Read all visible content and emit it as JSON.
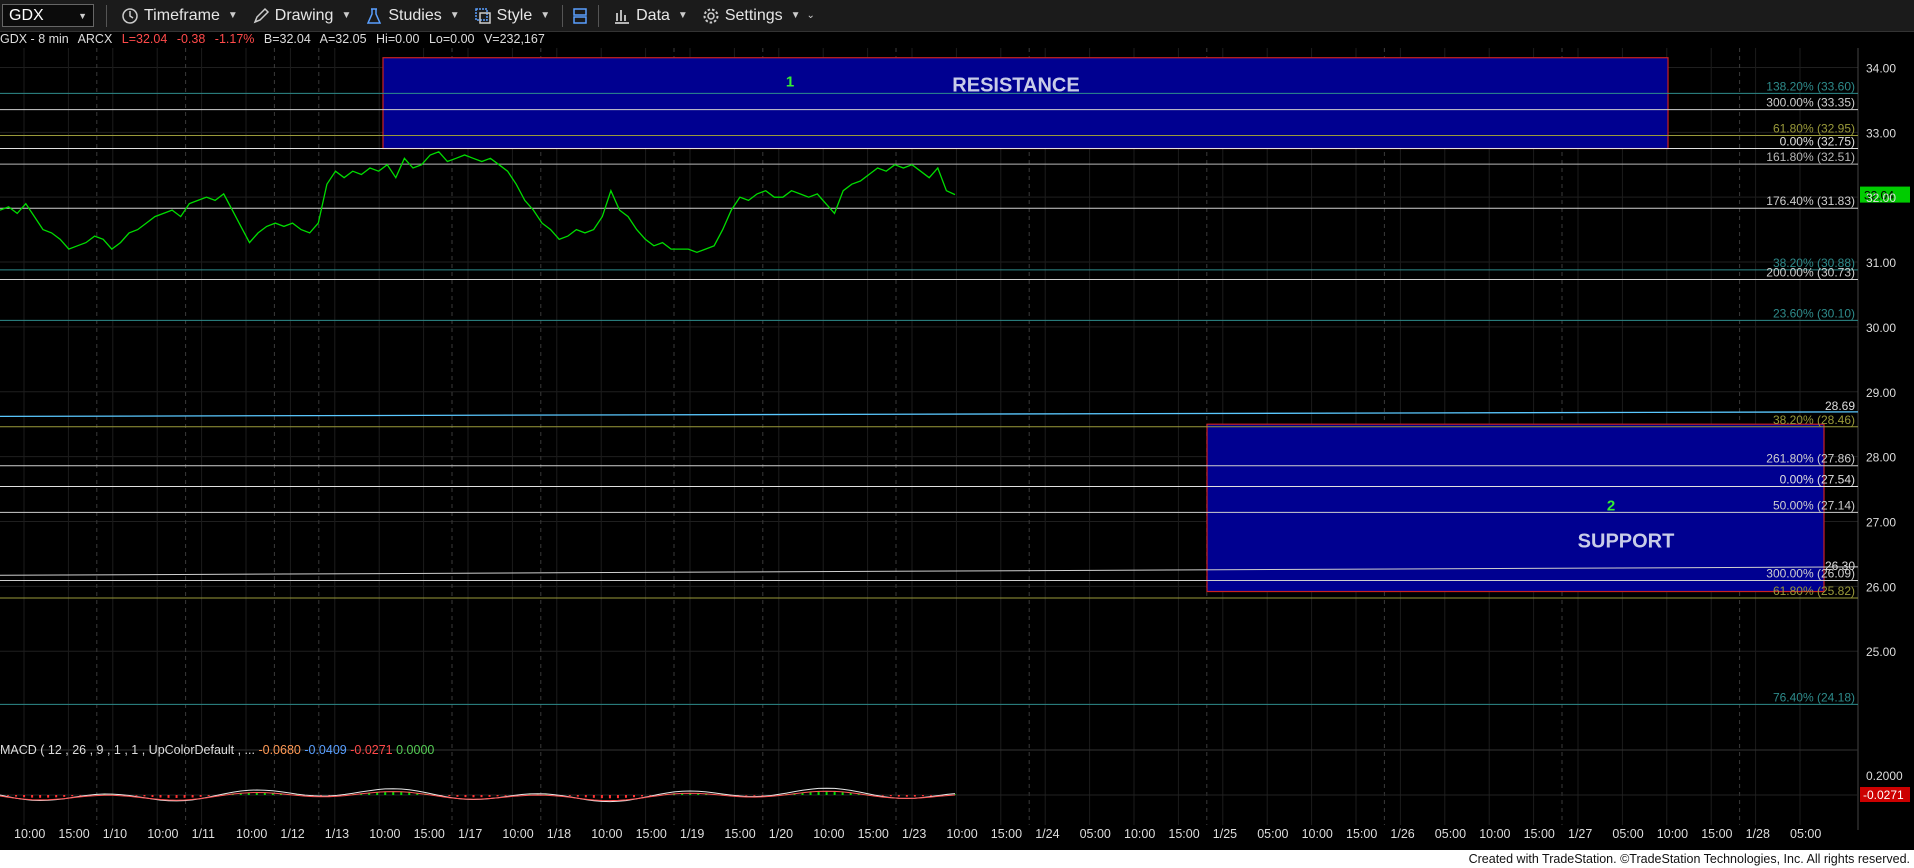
{
  "toolbar": {
    "symbol": "GDX",
    "items": [
      {
        "name": "timeframe",
        "label": "Timeframe",
        "icon": "clock-icon"
      },
      {
        "name": "drawing",
        "label": "Drawing",
        "icon": "pencil-icon"
      },
      {
        "name": "studies",
        "label": "Studies",
        "icon": "flask-icon"
      },
      {
        "name": "style",
        "label": "Style",
        "icon": "style-icon"
      },
      {
        "name": "data",
        "label": "Data",
        "icon": "bar-chart-icon"
      },
      {
        "name": "settings",
        "label": "Settings",
        "icon": "gear-icon"
      }
    ]
  },
  "info": {
    "symbol": "GDX - 8 min",
    "exchange": "ARCX",
    "last": "L=32.04",
    "change": "-0.38",
    "change_pct": "-1.17%",
    "bid": "B=32.04",
    "ask": "A=32.05",
    "hi": "Hi=0.00",
    "lo": "Lo=0.00",
    "volume": "V=232,167"
  },
  "macd": {
    "label": "MACD ( 12 , 26 , 9 , 1 , 1 , UpColorDefault , ...",
    "v1": "-0.0680",
    "v2": "-0.0409",
    "v3": "-0.0271",
    "v4": "0.0000",
    "axis_label": "0.2000",
    "last_badge": "-0.0271"
  },
  "footer": "Created with TradeStation. ©TradeStation Technologies, Inc. All rights reserved.",
  "colors": {
    "price": "#00dd00",
    "zone_fill": "#000090",
    "zone_border": "#cc2222",
    "up": "#00dd00",
    "down": "#ff3333"
  },
  "chart_data": {
    "type": "line",
    "ylim": [
      23.6,
      34.3
    ],
    "y_ticks": [
      "34.00",
      "33.00",
      "32.00",
      "31.00",
      "30.00",
      "29.00",
      "28.00",
      "27.00",
      "26.00",
      "25.00"
    ],
    "last_price": "32.04",
    "x_labels": [
      "10:00",
      "15:00",
      "1/10",
      "10:00",
      "1/11",
      "10:00",
      "1/12",
      "1/13",
      "10:00",
      "15:00",
      "1/17",
      "10:00",
      "1/18",
      "10:00",
      "15:00",
      "1/19",
      "15:00",
      "1/20",
      "10:00",
      "15:00",
      "1/23",
      "10:00",
      "15:00",
      "1/24",
      "05:00",
      "10:00",
      "15:00",
      "1/25",
      "05:00",
      "10:00",
      "15:00",
      "1/26",
      "05:00",
      "10:00",
      "15:00",
      "1/27",
      "05:00",
      "10:00",
      "15:00",
      "1/28",
      "05:00"
    ],
    "zones": [
      {
        "name": "resistance",
        "label": "RESISTANCE",
        "number": "1",
        "y_top": 34.15,
        "y_bottom": 32.75
      },
      {
        "name": "support",
        "label": "SUPPORT",
        "number": "2",
        "y_top": 28.5,
        "y_bottom": 25.92
      }
    ],
    "levels": [
      {
        "label": "138.20% (33.60)",
        "value": 33.6,
        "color": "#2e8b8b"
      },
      {
        "label": "300.00% (33.35)",
        "value": 33.35,
        "color": "#cfcfcf"
      },
      {
        "label": "61.80% (32.95)",
        "value": 32.95,
        "color": "#9a9a3a"
      },
      {
        "label": "0.00% (32.75)",
        "value": 32.75,
        "color": "#e0e0e0"
      },
      {
        "label": "161.80% (32.51)",
        "value": 32.51,
        "color": "#b8b8b8"
      },
      {
        "label": "176.40% (31.83)",
        "value": 31.83,
        "color": "#cfcfcf"
      },
      {
        "label": "38.20% (30.88)",
        "value": 30.88,
        "color": "#2e8b8b"
      },
      {
        "label": "200.00% (30.73)",
        "value": 30.73,
        "color": "#cfcfcf"
      },
      {
        "label": "23.60% (30.10)",
        "value": 30.1,
        "color": "#2e8b8b"
      },
      {
        "label": "38.20% (28.46)",
        "value": 28.46,
        "color": "#9a9a3a"
      },
      {
        "label": "261.80% (27.86)",
        "value": 27.86,
        "color": "#cfcfcf"
      },
      {
        "label": "0.00% (27.54)",
        "value": 27.54,
        "color": "#e0e0e0"
      },
      {
        "label": "50.00% (27.14)",
        "value": 27.14,
        "color": "#cfcfcf"
      },
      {
        "label": "300.00% (26.09)",
        "value": 26.09,
        "color": "#cfcfcf"
      },
      {
        "label": "61.80% (25.82)",
        "value": 25.82,
        "color": "#9a9a3a"
      },
      {
        "label": "76.40% (24.18)",
        "value": 24.18,
        "color": "#2e8b8b"
      }
    ],
    "trendlines": [
      {
        "label": "28.69",
        "value": 28.69,
        "color": "#5ac8ff"
      },
      {
        "label": "26.30",
        "value": 26.3,
        "color": "#cfcfcf"
      }
    ],
    "series": [
      {
        "values": [
          31.8,
          31.85,
          31.75,
          31.9,
          31.7,
          31.5,
          31.45,
          31.35,
          31.2,
          31.25,
          31.3,
          31.4,
          31.35,
          31.2,
          31.3,
          31.45,
          31.5,
          31.6,
          31.7,
          31.75,
          31.8,
          31.7,
          31.9,
          31.95,
          32.0,
          31.95,
          32.05,
          31.8,
          31.55,
          31.3,
          31.45,
          31.55,
          31.6,
          31.55,
          31.6,
          31.5,
          31.45,
          31.6,
          32.2,
          32.4,
          32.3,
          32.4,
          32.35,
          32.45,
          32.4,
          32.5,
          32.3,
          32.6,
          32.45,
          32.5,
          32.65,
          32.7,
          32.55,
          32.6,
          32.65,
          32.6,
          32.55,
          32.6,
          32.5,
          32.4,
          32.2,
          31.95,
          31.8,
          31.6,
          31.5,
          31.35,
          31.4,
          31.5,
          31.45,
          31.5,
          31.7,
          32.1,
          31.8,
          31.7,
          31.5,
          31.35,
          31.25,
          31.3,
          31.2,
          31.2,
          31.2,
          31.15,
          31.2,
          31.25,
          31.5,
          31.8,
          32.0,
          31.95,
          32.05,
          32.1,
          32.0,
          32.0,
          32.1,
          32.05,
          32.0,
          32.05,
          31.9,
          31.75,
          32.1,
          32.2,
          32.25,
          32.35,
          32.45,
          32.4,
          32.5,
          32.45,
          32.5,
          32.4,
          32.3,
          32.45,
          32.1,
          32.04
        ]
      }
    ]
  }
}
